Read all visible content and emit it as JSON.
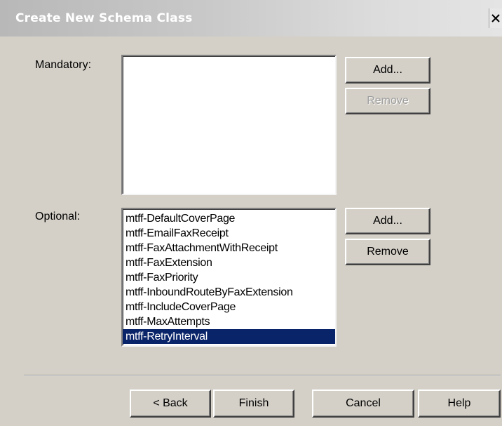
{
  "window": {
    "title": "Create New Schema Class",
    "close_glyph": "X"
  },
  "mandatory": {
    "label": "Mandatory:",
    "items": [],
    "add_label": "Add...",
    "remove_label": "Remove"
  },
  "optional": {
    "label": "Optional:",
    "items": [
      "mtff-DefaultCoverPage",
      "mtff-EmailFaxReceipt",
      "mtff-FaxAttachmentWithReceipt",
      "mtff-FaxExtension",
      "mtff-FaxPriority",
      "mtff-InboundRouteByFaxExtension",
      "mtff-IncludeCoverPage",
      "mtff-MaxAttempts",
      "mtff-RetryInterval"
    ],
    "selected_item": "mtff-RetryInterval",
    "add_label": "Add...",
    "remove_label": "Remove"
  },
  "footer": {
    "back_label": "< Back",
    "finish_label": "Finish",
    "cancel_label": "Cancel",
    "help_label": "Help"
  },
  "colors": {
    "dialog_bg": "#d4d0c8",
    "selection_bg": "#0a246a",
    "disabled_text": "#a0a0a0"
  }
}
